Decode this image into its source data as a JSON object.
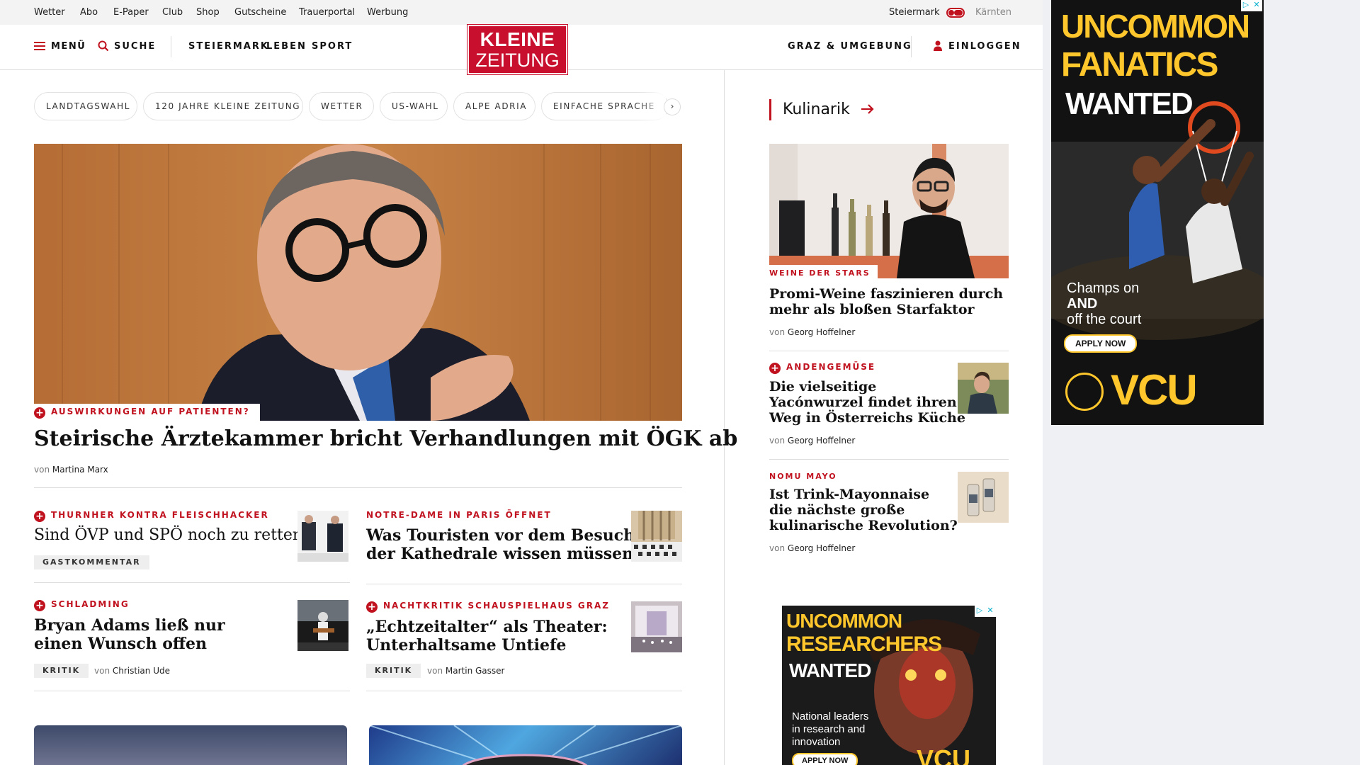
{
  "util_bar": {
    "links": [
      "Wetter",
      "Abo",
      "E-Paper",
      "Club",
      "Shop",
      "Gutscheine",
      "Trauerportal",
      "Werbung"
    ],
    "region_left": "Steiermark",
    "region_right": "Kärnten"
  },
  "header": {
    "menu_label": "MENÜ",
    "search_label": "SUCHE",
    "nav": [
      "STEIERMARK",
      "LEBEN",
      "SPORT"
    ],
    "logo_line1": "KLEINE",
    "logo_line2": "ZEITUNG",
    "region_link": "GRAZ & UMGEBUNG",
    "login_label": "EINLOGGEN"
  },
  "chips": [
    "LANDTAGSWAHL",
    "120 JAHRE KLEINE ZEITUNG",
    "WETTER",
    "US-WAHL",
    "ALPE ADRIA",
    "EINFACHE SPRACHE"
  ],
  "hero": {
    "kicker": "AUSWIRKUNGEN AUF PATIENTEN?",
    "title": "Steirische Ärztekammer bricht Verhandlungen mit ÖGK ab",
    "by_prefix": "von",
    "author": "Martina Marx"
  },
  "teasers": [
    {
      "kicker": "THURNHER KONTRA FLEISCHHACKER",
      "title": "Sind ÖVP und SPÖ noch zu retten?",
      "tag": "GASTKOMMENTAR"
    },
    {
      "kicker": "NOTRE-DAME IN PARIS ÖFFNET",
      "title_l1": "Was Touristen vor dem Besuch",
      "title_l2": "der Kathedrale wissen müssen"
    },
    {
      "kicker": "SCHLADMING",
      "title_l1": "Bryan Adams ließ nur",
      "title_l2": "einen Wunsch offen",
      "tag": "KRITIK",
      "by_prefix": "von",
      "author": "Christian Ude"
    },
    {
      "kicker": "NACHTKRITIK SCHAUSPIELHAUS GRAZ",
      "title_l1": "„Echtzeitalter“ als Theater:",
      "title_l2": "Unterhaltsame Untiefe",
      "tag": "KRITIK",
      "by_prefix": "von",
      "author": "Martin Gasser"
    }
  ],
  "sidebar": {
    "section_title": "Kulinarik",
    "lead": {
      "kicker": "WEINE DER STARS",
      "title_l1": "Promi-Weine faszinieren durch",
      "title_l2": "mehr als bloßen Starfaktor",
      "by_prefix": "von",
      "author": "Georg Hoffelner"
    },
    "items": [
      {
        "kicker": "ANDENGEMÜSE",
        "title_l1": "Die vielseitige",
        "title_l2": "Yacónwurzel findet ihren",
        "title_l3": "Weg in Österreichs Küche",
        "by_prefix": "von",
        "author": "Georg Hoffelner"
      },
      {
        "kicker": "NOMU MAYO",
        "title_l1": "Ist Trink-Mayonnaise",
        "title_l2": "die nächste große",
        "title_l3": "kulinarische Revolution?",
        "by_prefix": "von",
        "author": "Georg Hoffelner"
      }
    ]
  },
  "ads": {
    "top": {
      "l1": "UNCOMMON",
      "l2": "FANATICS",
      "l3": "WANTED",
      "tag1": "Champs on",
      "tag2": "AND",
      "tag3": "off the court",
      "cta": "APPLY NOW",
      "brand": "VCU"
    },
    "side": {
      "l1": "UNCOMMON",
      "l2": "RESEARCHERS",
      "l3": "WANTED",
      "tag1": "National leaders",
      "tag2": "in research and",
      "tag3": "innovation",
      "cta": "APPLY NOW",
      "brand": "VCU"
    }
  },
  "colors": {
    "brand_red": "#c0121f",
    "ad_yellow": "#ffc72c"
  }
}
